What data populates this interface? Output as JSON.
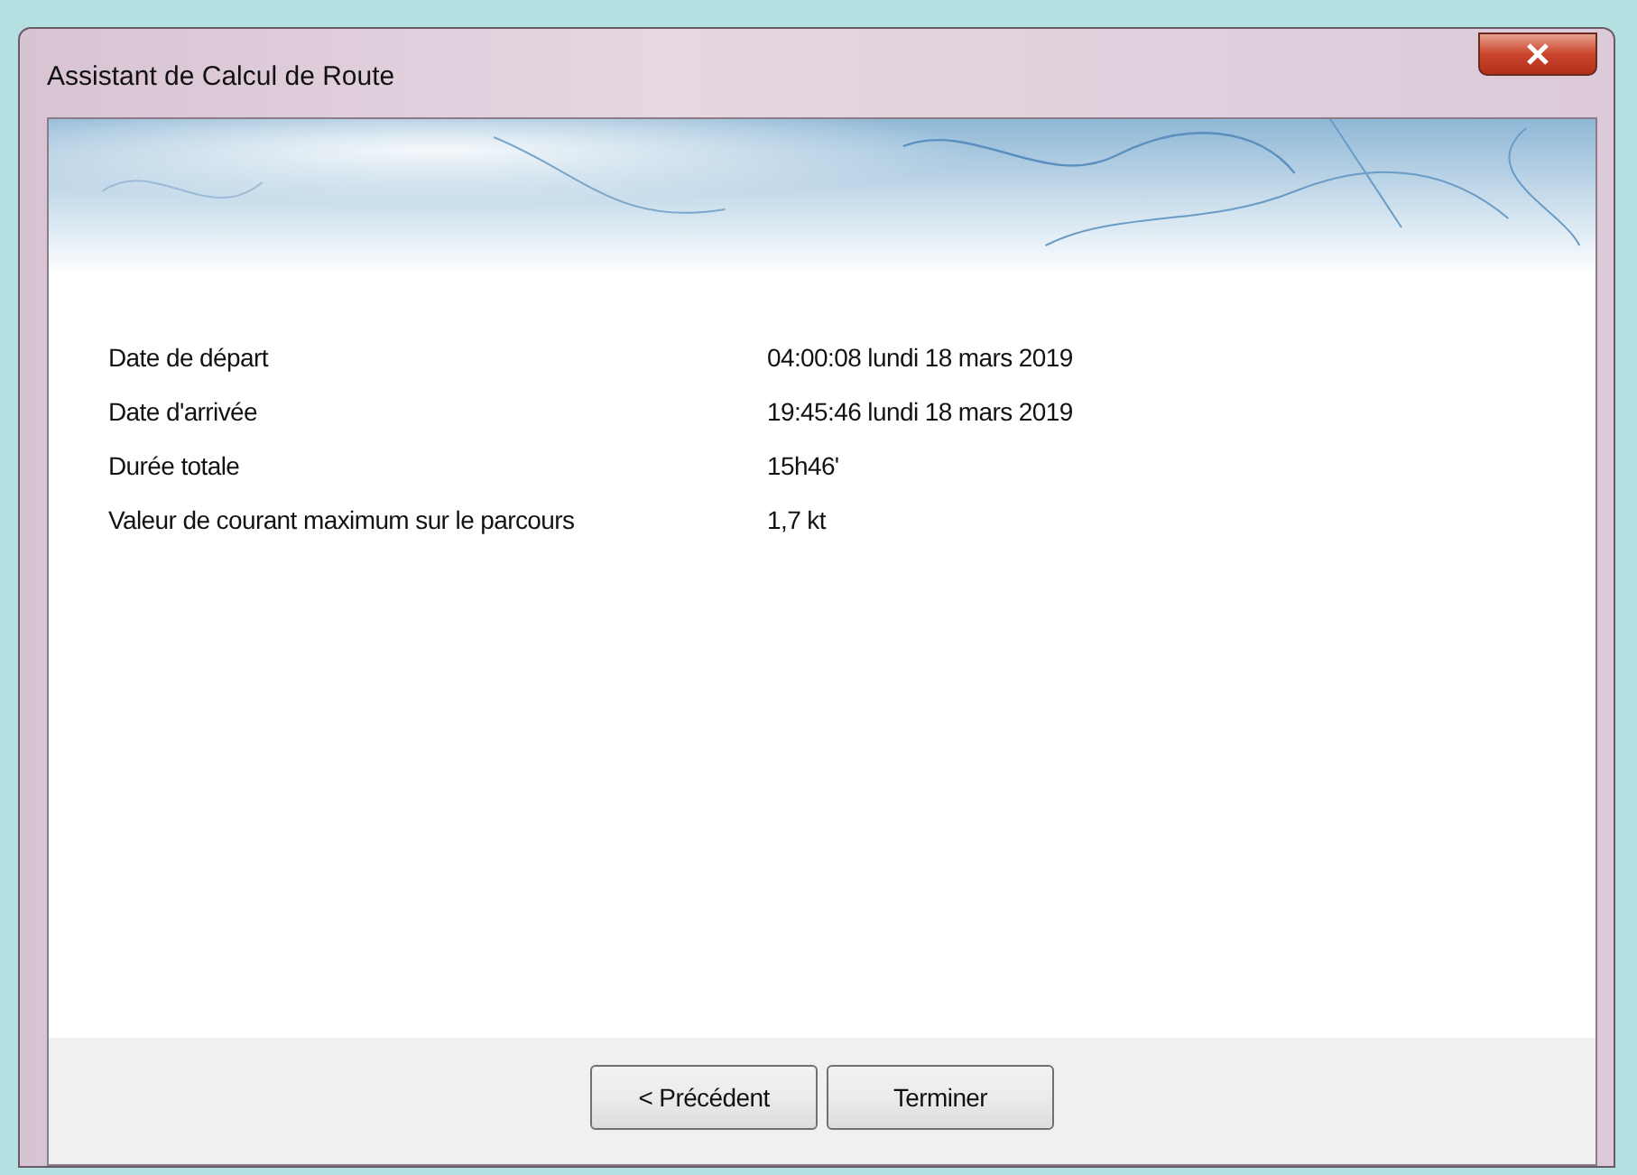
{
  "window": {
    "title": "Assistant de Calcul de Route"
  },
  "fields": [
    {
      "label": "Date de départ",
      "value": "04:00:08 lundi 18 mars 2019"
    },
    {
      "label": "Date d'arrivée",
      "value": "19:45:46 lundi 18 mars 2019"
    },
    {
      "label": "Durée totale",
      "value": "15h46'"
    },
    {
      "label": "Valeur de courant maximum sur le parcours",
      "value": "1,7 kt"
    }
  ],
  "buttons": [
    {
      "label": "< Précédent"
    },
    {
      "label": "Terminer"
    }
  ]
}
